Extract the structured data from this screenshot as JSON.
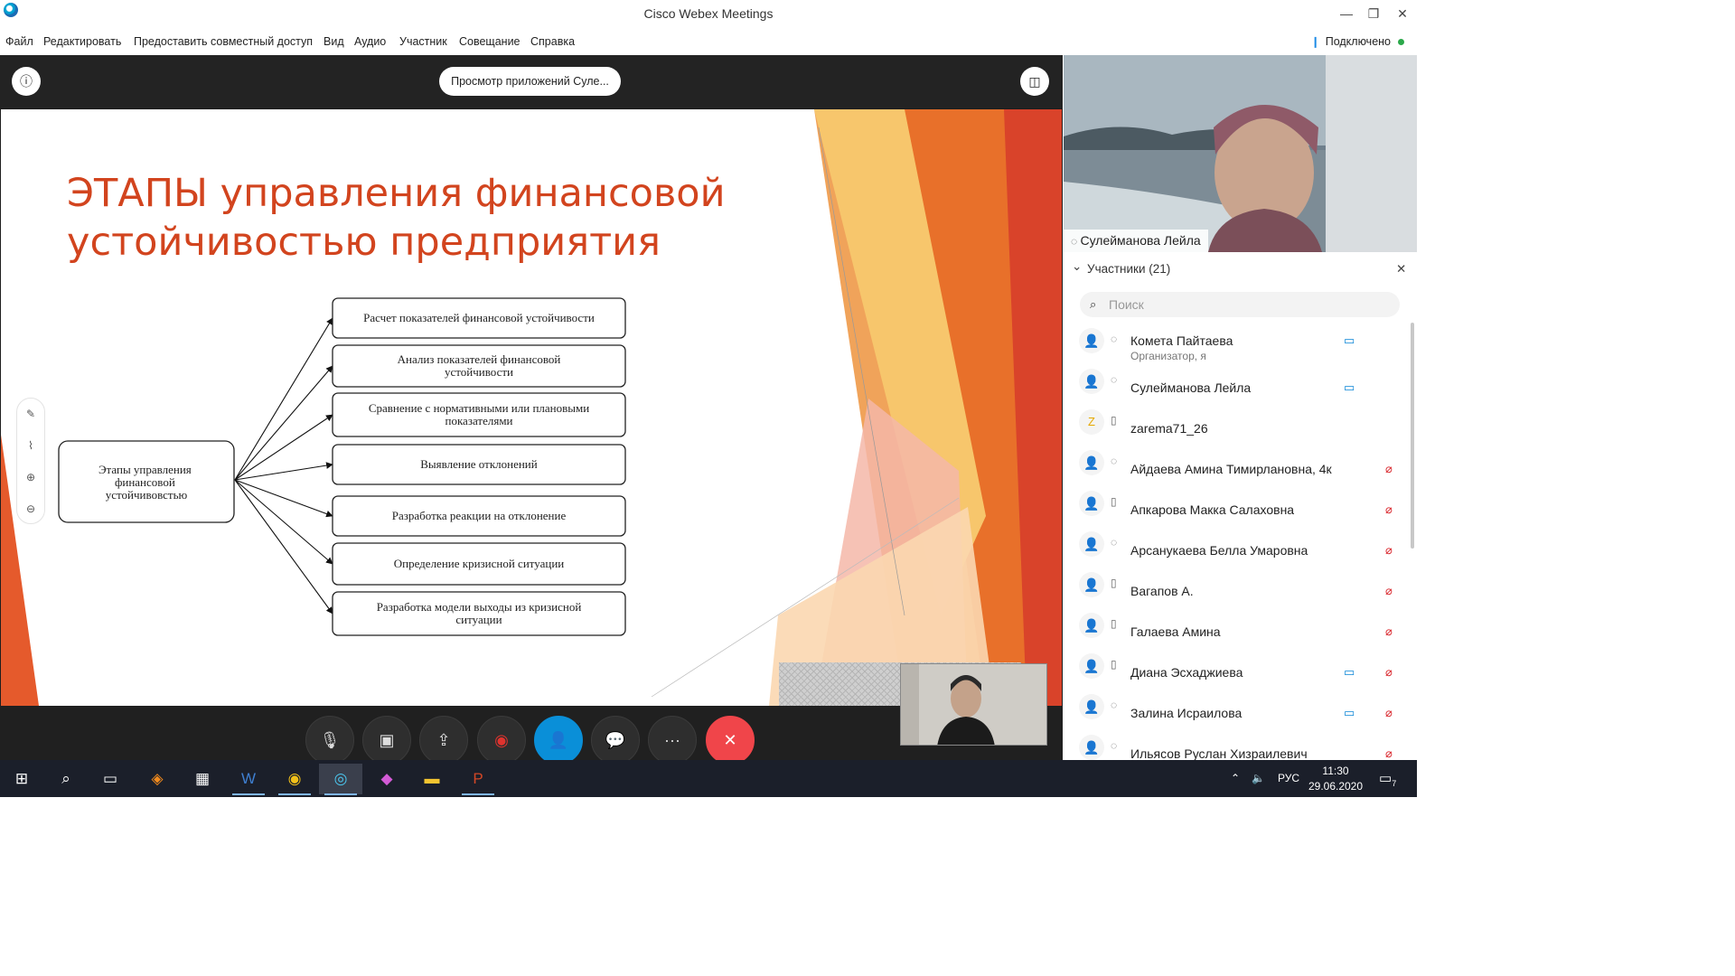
{
  "window": {
    "title": "Cisco Webex Meetings",
    "minimize": "—",
    "restore": "❐",
    "close": "✕"
  },
  "menu": [
    "Файл",
    "Редактировать",
    "Предоставить совместный доступ",
    "Вид",
    "Аудио",
    "Участник",
    "Совещание",
    "Справка"
  ],
  "connection": {
    "status": "Подключено",
    "color": "#2ba84a"
  },
  "stage": {
    "info_icon": "info-icon",
    "share_label": "Просмотр приложений Суле...",
    "layout_icon": "layout-icon"
  },
  "slide": {
    "title_line1": "ЭТАПЫ управления финансовой",
    "title_line2": "устойчивостью предприятия",
    "title_color": "#d2441e",
    "center_lines": [
      "Этапы управления",
      "финансовой",
      "устойчивовстью"
    ],
    "stages": [
      [
        "Расчет показателей финансовой устойчивости"
      ],
      [
        "Анализ показателей финансовой",
        "устойчивости"
      ],
      [
        "Сравнение с нормативными или плановыми",
        "показателями"
      ],
      [
        "Выявление отклонений"
      ],
      [
        "Разработка реакции на отклонение"
      ],
      [
        "Определение кризисной ситуации"
      ],
      [
        "Разработка модели выходы из кризисной",
        "ситуации"
      ]
    ]
  },
  "pen_tools": [
    "✎",
    "⌇",
    "⊕",
    "⊖"
  ],
  "controls": [
    {
      "name": "mute-button",
      "icon": "🎙"
    },
    {
      "name": "video-button",
      "icon": "▣"
    },
    {
      "name": "share-button",
      "icon": "⇪"
    },
    {
      "name": "record-button",
      "icon": "◉"
    },
    {
      "name": "participants-button",
      "icon": "👤"
    },
    {
      "name": "chat-button",
      "icon": "💬"
    },
    {
      "name": "more-button",
      "icon": "···"
    },
    {
      "name": "leave-button",
      "icon": "✕"
    }
  ],
  "sidebar": {
    "video_name": "Сулейманова Лейла",
    "participants_header": "Участники (21)",
    "search_placeholder": "Поиск",
    "participants": [
      {
        "name": "Комета Пайтаева",
        "role": "Организатор, я",
        "device": "headset",
        "video": true,
        "muted": false
      },
      {
        "name": "Сулейманова Лейла",
        "role": "",
        "device": "headset",
        "video": true,
        "muted": false
      },
      {
        "name": "zarema71_26",
        "role": "",
        "device": "phone",
        "video": false,
        "muted": false,
        "letter": "Z"
      },
      {
        "name": "Айдаева Амина Тимирлановна, 4к",
        "role": "",
        "device": "headset",
        "video": false,
        "muted": true
      },
      {
        "name": "Апкарова Макка Салаховна",
        "role": "",
        "device": "phone",
        "video": false,
        "muted": true
      },
      {
        "name": "Арсанукаева Белла Умаровна",
        "role": "",
        "device": "headset",
        "video": false,
        "muted": true
      },
      {
        "name": "Вагапов А.",
        "role": "",
        "device": "phone",
        "video": false,
        "muted": true
      },
      {
        "name": "Галаева Амина",
        "role": "",
        "device": "phone",
        "video": false,
        "muted": true
      },
      {
        "name": "Диана Эсхаджиева",
        "role": "",
        "device": "phone",
        "video": true,
        "muted": true
      },
      {
        "name": "Залина Исраилова",
        "role": "",
        "device": "headset",
        "video": true,
        "muted": true
      },
      {
        "name": "Ильясов Руслан Хизраилевич",
        "role": "",
        "device": "headset",
        "video": false,
        "muted": true
      }
    ]
  },
  "taskbar": {
    "apps": [
      "windows-start-icon",
      "search-icon",
      "task-view-icon",
      "avast-icon",
      "calculator-icon",
      "word-icon",
      "chrome-icon",
      "webex-icon",
      "paint3d-icon",
      "explorer-icon",
      "powerpoint-icon"
    ],
    "language": "РУС",
    "time": "11:30",
    "date": "29.06.2020",
    "notifications": "7"
  }
}
